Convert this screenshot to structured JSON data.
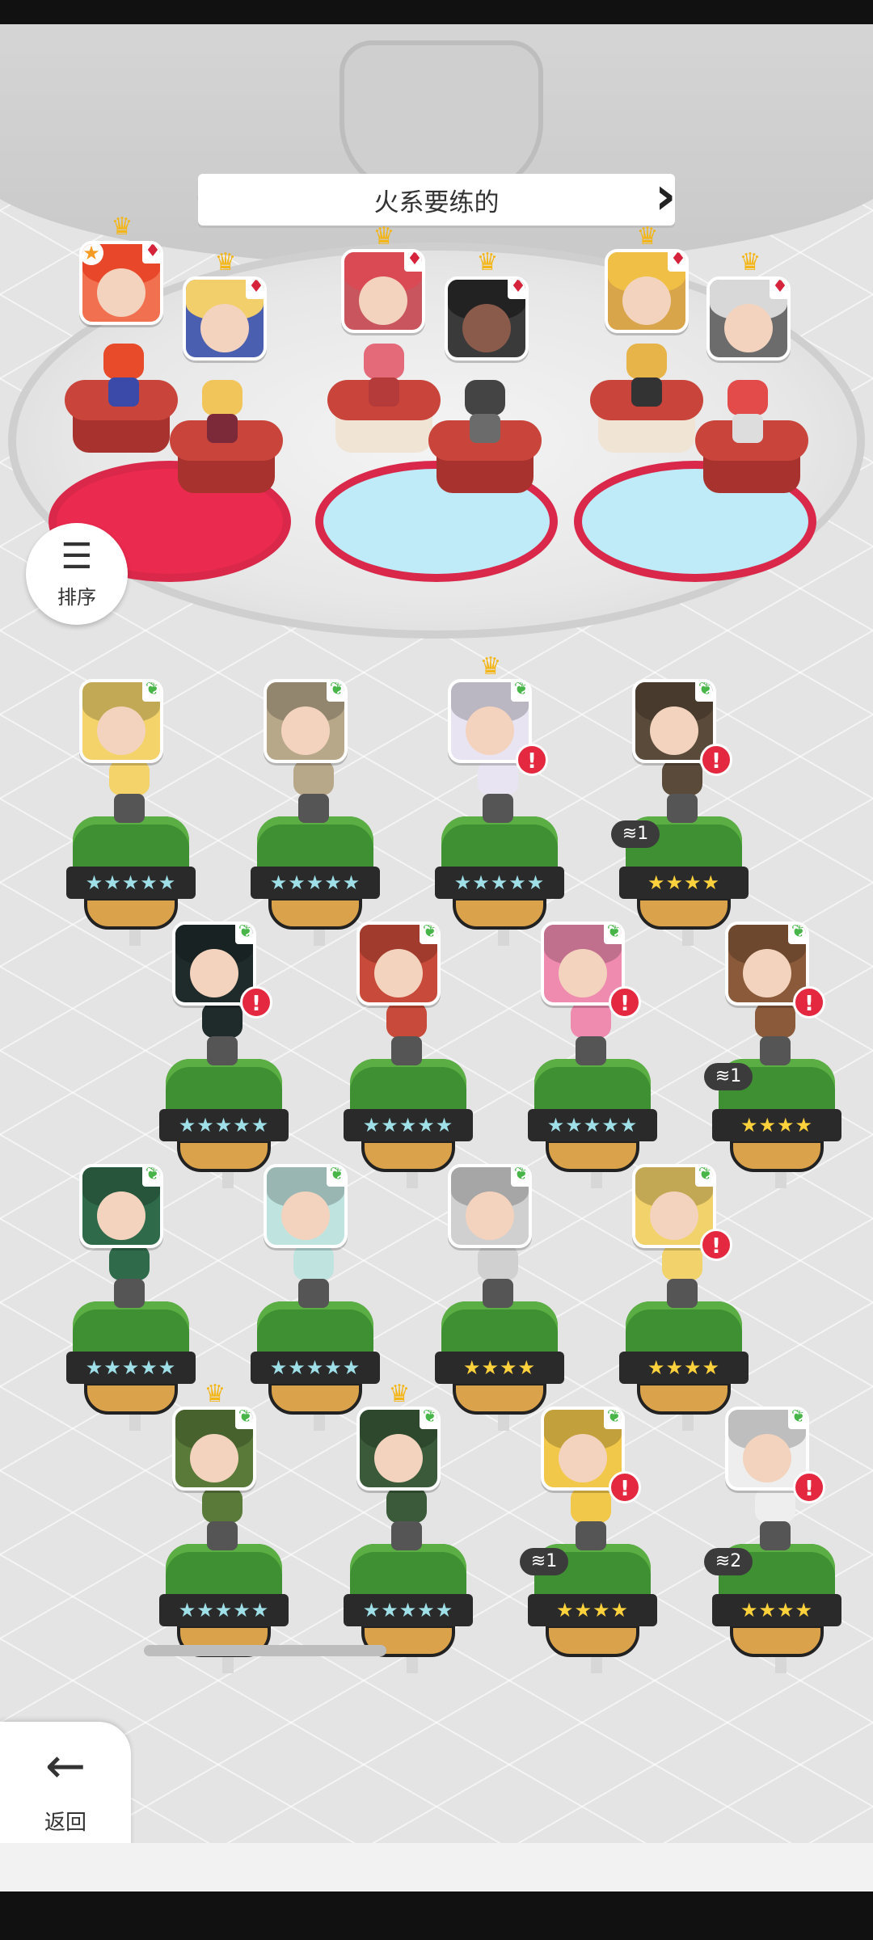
{
  "header": {
    "title": "火系要练的"
  },
  "sort_button": {
    "icon": "sort-icon",
    "label": "排序"
  },
  "back_button": {
    "icon": "arrow-left-icon",
    "label": "返回"
  },
  "featured": [
    {
      "has_crown": true,
      "element": "fire",
      "starred": true
    },
    {
      "has_crown": true,
      "element": "fire"
    },
    {
      "has_crown": true,
      "element": "fire"
    },
    {
      "has_crown": true,
      "element": "fire"
    },
    {
      "has_crown": true,
      "element": "fire"
    },
    {
      "has_crown": true,
      "element": "fire"
    }
  ],
  "roster": [
    {
      "stars": "★★★★★",
      "crown": false,
      "alert": false
    },
    {
      "stars": "★★★★★",
      "crown": false,
      "alert": false
    },
    {
      "stars": "★★★★★",
      "crown": true,
      "alert": true
    },
    {
      "stars": "★★★★",
      "crown": false,
      "alert": true,
      "level": "1"
    },
    {
      "stars": "★★★★★",
      "crown": false,
      "alert": true
    },
    {
      "stars": "★★★★★",
      "crown": false,
      "alert": false
    },
    {
      "stars": "★★★★★",
      "crown": false,
      "alert": true
    },
    {
      "stars": "★★★★",
      "crown": false,
      "alert": true,
      "level": "1"
    },
    {
      "stars": "★★★★★",
      "crown": false,
      "alert": false
    },
    {
      "stars": "★★★★★",
      "crown": false,
      "alert": false
    },
    {
      "stars": "★★★★",
      "crown": false,
      "alert": false
    },
    {
      "stars": "★★★★",
      "crown": false,
      "alert": true
    },
    {
      "stars": "★★★★★",
      "crown": true,
      "alert": false
    },
    {
      "stars": "★★★★★",
      "crown": true,
      "alert": false
    },
    {
      "stars": "★★★★",
      "crown": false,
      "alert": true,
      "level": "1"
    },
    {
      "stars": "★★★★",
      "crown": false,
      "alert": true,
      "level": "2"
    }
  ],
  "colors": {
    "fire_pad": "#ea2a4e",
    "leaf": "#48b548",
    "alert": "#e3283f",
    "crown": "#f4b516"
  }
}
